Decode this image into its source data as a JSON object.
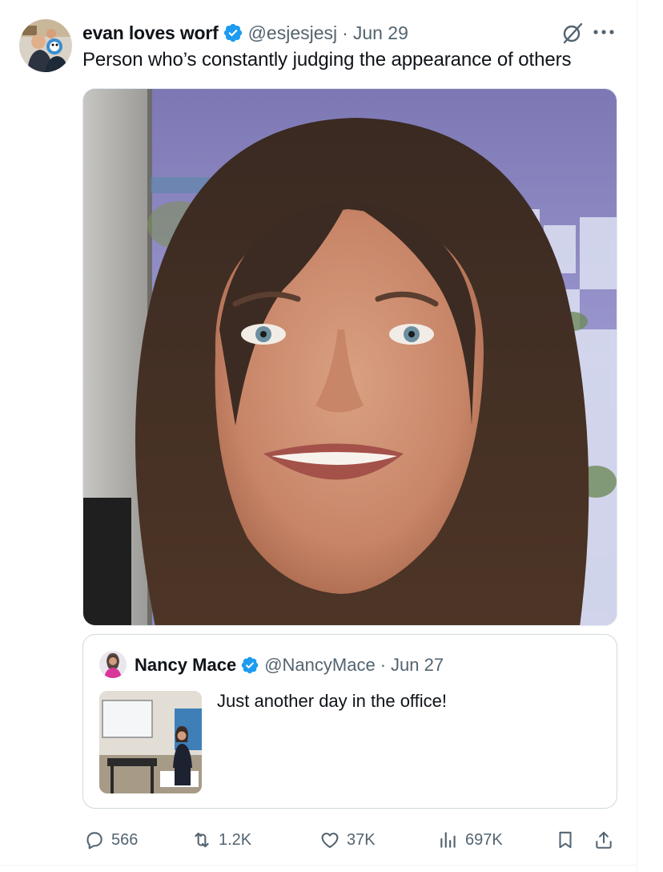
{
  "tweet": {
    "author_name": "evan loves worf",
    "handle": "@esjesjesj",
    "separator": "·",
    "date": "Jun 29",
    "text": "Person who’s constantly judging the appearance of others",
    "image_subject": "smiling woman with brown hair, close-up portrait"
  },
  "quoted_tweet": {
    "author_name": "Nancy Mace",
    "handle": "@NancyMace",
    "separator": "·",
    "date": "Jun 27",
    "text": "Just another day in the office!",
    "thumbnail_subject": "woman seated in an office"
  },
  "actions": {
    "replies": "566",
    "reposts": "1.2K",
    "likes": "37K",
    "views": "697K"
  },
  "colors": {
    "verified": "#1d9bf0",
    "secondary_text": "#536471",
    "primary_text": "#0f1419",
    "border": "#cfd9de"
  },
  "icons": [
    "grok-icon",
    "more-icon",
    "verified-icon",
    "reply-icon",
    "repost-icon",
    "like-icon",
    "views-icon",
    "bookmark-icon",
    "share-icon"
  ]
}
